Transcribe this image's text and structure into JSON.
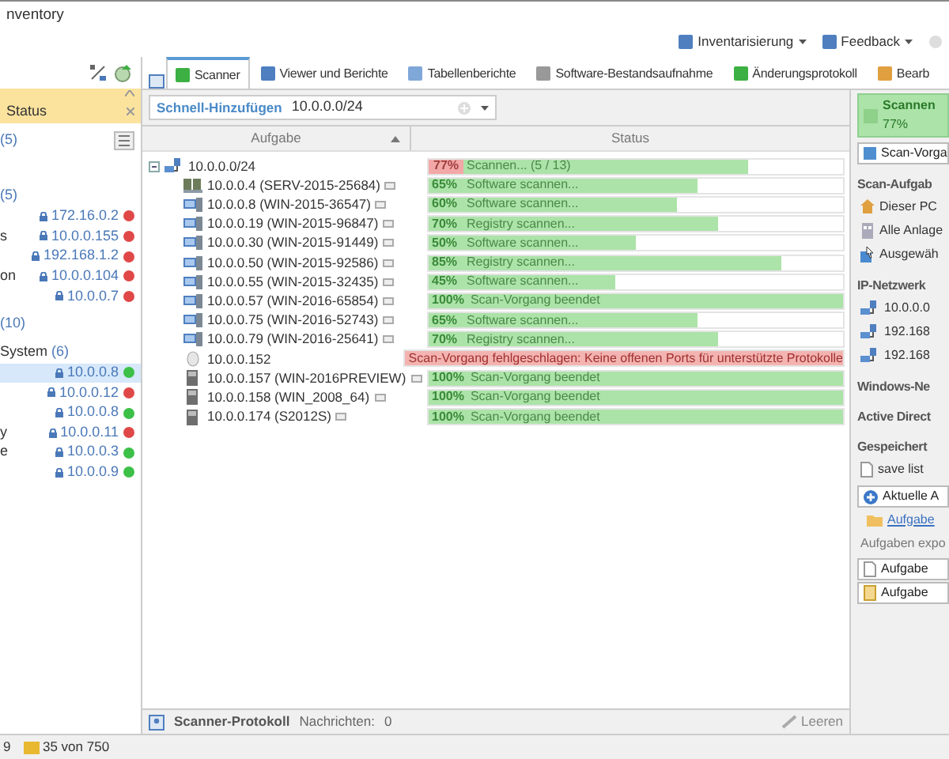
{
  "window": {
    "title": "nventory"
  },
  "header_menus": [
    {
      "label": "Inventarisierung"
    },
    {
      "label": "Feedback"
    }
  ],
  "left_panel": {
    "filter": {
      "title": "Status"
    },
    "summary": "(5)",
    "groups": [
      {
        "label": "(5)",
        "devices": [
          {
            "ip": "172.16.0.2",
            "color": "#e04848",
            "selected": false
          },
          {
            "name": "s",
            "ip": "10.0.0.155",
            "color": "#e04848",
            "selected": false
          },
          {
            "ip": "192.168.1.2",
            "color": "#e04848",
            "selected": false
          },
          {
            "name": "on",
            "ip": "10.0.0.104",
            "color": "#e04848",
            "selected": false
          },
          {
            "ip": "10.0.0.7",
            "color": "#e04848",
            "selected": false
          }
        ]
      },
      {
        "label": "(10)",
        "children": [
          {
            "label": "System (6)",
            "devices": [
              {
                "ip": "10.0.0.8",
                "color": "#3cc048",
                "selected": true
              },
              {
                "ip": "10.0.0.12",
                "color": "#e04848",
                "selected": false
              },
              {
                "ip": "10.0.0.8",
                "color": "#3cc048",
                "selected": false
              },
              {
                "name": "y",
                "ip": "10.0.0.11",
                "color": "#e04848",
                "selected": false
              },
              {
                "name": "e",
                "ip": "10.0.0.3",
                "color": "#3cc048",
                "selected": false
              },
              {
                "ip": "10.0.0.9",
                "color": "#3cc048",
                "selected": false
              }
            ]
          }
        ]
      }
    ]
  },
  "tabs": [
    {
      "label": "Scanner",
      "selected": true
    },
    {
      "label": "Viewer und Berichte",
      "selected": false
    },
    {
      "label": "Tabellenberichte",
      "selected": false
    },
    {
      "label": "Software-Bestandsaufnahme",
      "selected": false
    },
    {
      "label": "Änderungsprotokoll",
      "selected": false
    },
    {
      "label": "Bearb",
      "selected": false
    }
  ],
  "quick_add": {
    "label": "Schnell-Hinzufügen",
    "value": "10.0.0.0/24"
  },
  "table": {
    "columns": [
      {
        "label": "Aufgabe",
        "sorted_ascending": true
      },
      {
        "label": "Status"
      }
    ],
    "rows": [
      {
        "task": "10.0.0.0/24",
        "kind": "network",
        "expanded": true,
        "percent": "77%",
        "status": "Scannen... (5 / 13)",
        "level": 0.77,
        "children": [
          {
            "task": "10.0.0.4 (SERV-2015-25684)",
            "kind": "server",
            "info": true,
            "failed": false,
            "percent": "65%",
            "status": "Software scannen...",
            "level": 0.65
          },
          {
            "task": "10.0.0.8 (WIN-2015-36547)",
            "kind": "workstation",
            "info": true,
            "failed": false,
            "percent": "60%",
            "status": "Software scannen...",
            "level": 0.6
          },
          {
            "task": "10.0.0.19 (WIN-2015-96847)",
            "kind": "workstation",
            "info": true,
            "failed": false,
            "percent": "70%",
            "status": "Registry scannen...",
            "level": 0.7
          },
          {
            "task": "10.0.0.30 (WIN-2015-91449)",
            "kind": "workstation",
            "info": true,
            "failed": false,
            "percent": "50%",
            "status": "Software scannen...",
            "level": 0.5
          },
          {
            "task": "10.0.0.50 (WIN-2015-92586)",
            "kind": "workstation",
            "info": true,
            "failed": false,
            "percent": "85%",
            "status": "Registry scannen...",
            "level": 0.85
          },
          {
            "task": "10.0.0.55 (WIN-2015-32435)",
            "kind": "workstation",
            "info": true,
            "failed": false,
            "percent": "45%",
            "status": "Software scannen...",
            "level": 0.45
          },
          {
            "task": "10.0.0.57 (WIN-2016-65854)",
            "kind": "workstation",
            "info": true,
            "failed": false,
            "percent": "100%",
            "status": "Scan-Vorgang beendet",
            "level": 1
          },
          {
            "task": "10.0.0.75 (WIN-2016-52743)",
            "kind": "workstation",
            "info": true,
            "failed": false,
            "percent": "65%",
            "status": "Software scannen...",
            "level": 0.65
          },
          {
            "task": "10.0.0.79 (WIN-2016-25641)",
            "kind": "workstation",
            "info": true,
            "failed": false,
            "percent": "70%",
            "status": "Registry scannen...",
            "level": 0.7
          },
          {
            "task": "10.0.0.152",
            "kind": "unknown",
            "info": false,
            "failed": true,
            "status": "Scan-Vorgang fehlgeschlagen: Keine offenen Ports für unterstützte Protokolle"
          },
          {
            "task": "10.0.0.157 (WIN-2016PREVIEW)",
            "kind": "tower",
            "info": true,
            "failed": false,
            "percent": "100%",
            "status": "Scan-Vorgang beendet",
            "level": 1
          },
          {
            "task": "10.0.0.158 (WIN_2008_64)",
            "kind": "tower",
            "info": true,
            "failed": false,
            "percent": "100%",
            "status": "Scan-Vorgang beendet",
            "level": 1
          },
          {
            "task": "10.0.0.174 (S2012S)",
            "kind": "tower",
            "info": true,
            "failed": false,
            "percent": "100%",
            "status": "Scan-Vorgang beendet",
            "level": 1
          }
        ]
      }
    ]
  },
  "log_bar": {
    "title": "Scanner-Protokoll",
    "messages_label": "Nachrichten:",
    "messages_count": "0",
    "clear": "Leeren"
  },
  "right_panel": {
    "progress": {
      "title": "Scannen",
      "percent": "77%"
    },
    "stop_button": "Scan-Vorga",
    "sections": [
      {
        "heading": "Scan-Aufgab",
        "items": [
          {
            "label": "Dieser PC",
            "kind": "home"
          },
          {
            "label": "Alle Anlage",
            "kind": "building"
          },
          {
            "label": "Ausgewäh",
            "kind": "select"
          }
        ]
      },
      {
        "heading": "IP-Netzwerk",
        "items": [
          {
            "label": "10.0.0.0",
            "kind": "network"
          },
          {
            "label": "192.168",
            "kind": "network"
          },
          {
            "label": "192.168",
            "kind": "network"
          }
        ]
      },
      {
        "heading": "Windows-Ne"
      },
      {
        "heading": "Active Direct"
      },
      {
        "heading": "Gespeichert",
        "items": [
          {
            "label": "save list",
            "kind": "file"
          }
        ]
      }
    ],
    "add_button": "Aktuelle A",
    "open_link": "Aufgabe",
    "export_label": "Aufgaben expo",
    "export_buttons": [
      "Aufgabe",
      "Aufgabe"
    ]
  },
  "status_bar": [
    "9",
    "35 von 750"
  ]
}
